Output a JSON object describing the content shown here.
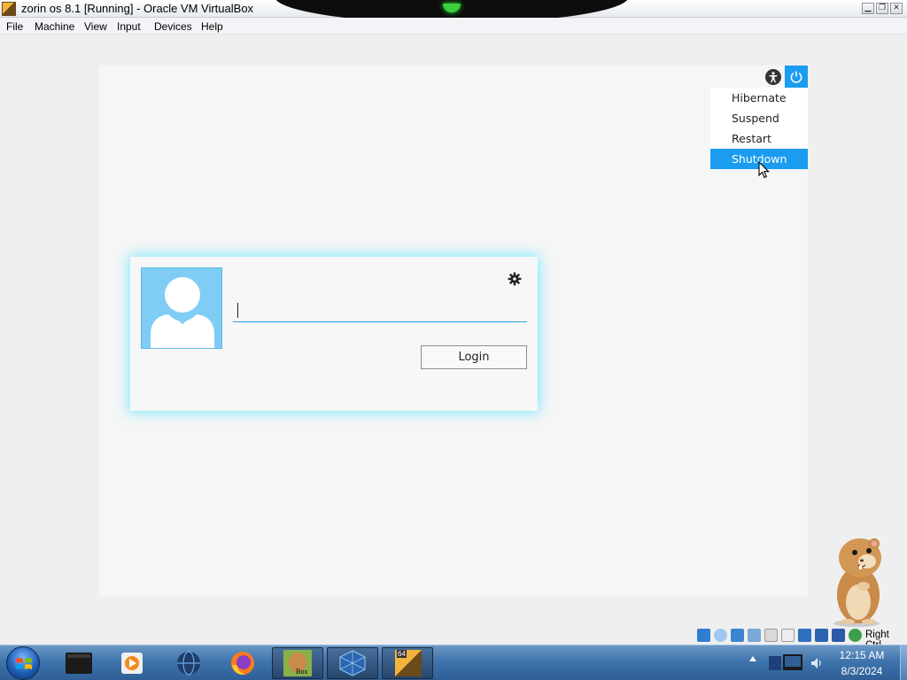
{
  "window": {
    "title": "zorin os 8.1 [Running] - Oracle VM VirtualBox"
  },
  "menubar": {
    "items": [
      "File",
      "Machine",
      "View",
      "Input",
      "Devices",
      "Help"
    ]
  },
  "guest": {
    "power_menu": {
      "items": [
        {
          "label": "Hibernate",
          "highlighted": false
        },
        {
          "label": "Suspend",
          "highlighted": false
        },
        {
          "label": "Restart",
          "highlighted": false
        },
        {
          "label": "Shutdown",
          "highlighted": true
        }
      ]
    },
    "login": {
      "username_value": "",
      "login_label": "Login"
    },
    "accent_color": "#1a9cf0"
  },
  "statusbar": {
    "host_key": "Right Ctrl"
  },
  "taskbar": {
    "clock_time": "12:15 AM",
    "clock_date": "8/3/2024",
    "vbox_badge": "Box",
    "bits_badge": "64"
  }
}
